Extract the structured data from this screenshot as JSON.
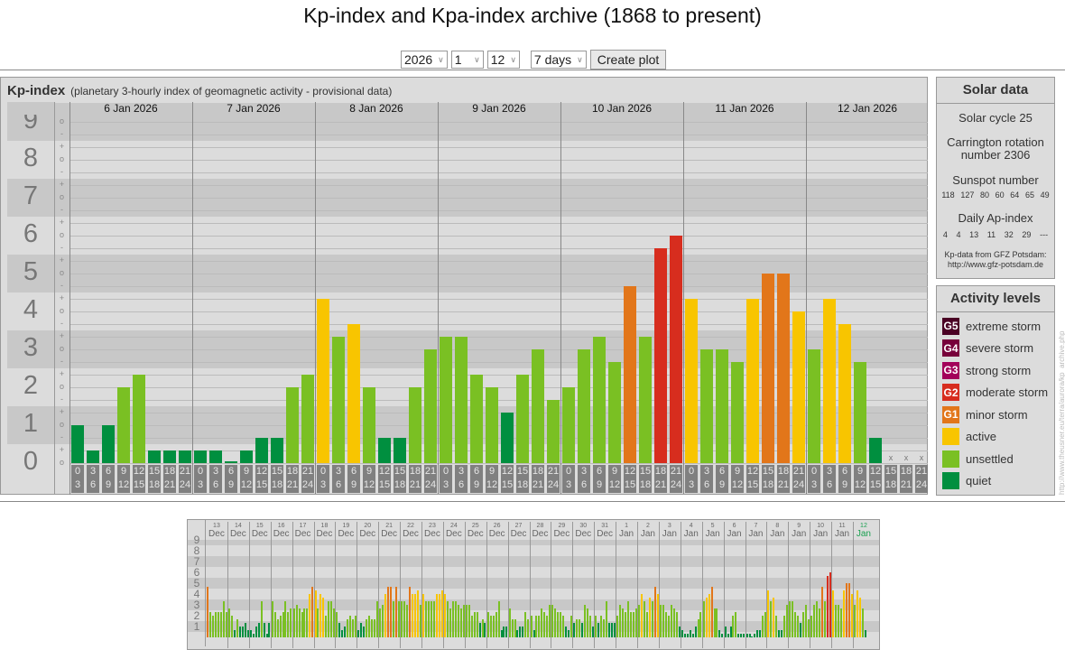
{
  "title": "Kp-index and Kpa-index archive (1868 to present)",
  "controls": {
    "year": "2026",
    "month": "1",
    "day": "12",
    "range": "7 days",
    "create_label": "Create plot"
  },
  "panel": {
    "heading": "Kp-index",
    "subheading": "(planetary 3-hourly index of geomagnetic activity - provisional data)"
  },
  "chart_data": {
    "type": "bar",
    "title": "Kp-index",
    "y_ticks": [
      "0",
      "1",
      "2",
      "3",
      "4",
      "5",
      "6",
      "7",
      "8",
      "9"
    ],
    "y_signs": [
      "+",
      "o",
      "-"
    ],
    "ylim": [
      0,
      9
    ],
    "days": [
      "6 Jan 2026",
      "7 Jan 2026",
      "8 Jan 2026",
      "9 Jan 2026",
      "10 Jan 2026",
      "11 Jan 2026",
      "12 Jan 2026"
    ],
    "hour_intervals": [
      [
        "0",
        "3"
      ],
      [
        "3",
        "6"
      ],
      [
        "6",
        "9"
      ],
      [
        "9",
        "12"
      ],
      [
        "12",
        "15"
      ],
      [
        "15",
        "18"
      ],
      [
        "18",
        "21"
      ],
      [
        "21",
        "24"
      ]
    ],
    "missing_mark": "x",
    "values": [
      [
        1,
        0.33,
        1,
        2,
        2.33,
        0.33,
        0.33,
        0.33
      ],
      [
        0.33,
        0.33,
        0,
        0.33,
        0.67,
        0.67,
        2,
        2.33
      ],
      [
        4.33,
        3.33,
        3.67,
        2,
        0.67,
        0.67,
        2,
        3
      ],
      [
        3.33,
        3.33,
        2.33,
        2,
        1.33,
        2.33,
        3,
        1.67
      ],
      [
        2,
        3,
        3.33,
        2.67,
        4.67,
        3.33,
        5.67,
        6
      ],
      [
        4.33,
        3,
        3,
        2.67,
        4.33,
        5,
        5,
        4
      ],
      [
        3,
        4.33,
        3.67,
        2.67,
        0.67,
        null,
        null,
        null
      ]
    ]
  },
  "overview_chart": {
    "type": "bar",
    "y_ticks": [
      "1",
      "2",
      "3",
      "4",
      "5",
      "6",
      "7",
      "8",
      "9"
    ],
    "days": [
      {
        "d": "13",
        "m": "Dec"
      },
      {
        "d": "14",
        "m": "Dec"
      },
      {
        "d": "15",
        "m": "Dec"
      },
      {
        "d": "16",
        "m": "Dec"
      },
      {
        "d": "17",
        "m": "Dec"
      },
      {
        "d": "18",
        "m": "Dec"
      },
      {
        "d": "19",
        "m": "Dec"
      },
      {
        "d": "20",
        "m": "Dec"
      },
      {
        "d": "21",
        "m": "Dec"
      },
      {
        "d": "22",
        "m": "Dec"
      },
      {
        "d": "23",
        "m": "Dec"
      },
      {
        "d": "24",
        "m": "Dec"
      },
      {
        "d": "25",
        "m": "Dec"
      },
      {
        "d": "26",
        "m": "Dec"
      },
      {
        "d": "27",
        "m": "Dec"
      },
      {
        "d": "28",
        "m": "Dec"
      },
      {
        "d": "29",
        "m": "Dec"
      },
      {
        "d": "30",
        "m": "Dec"
      },
      {
        "d": "31",
        "m": "Dec"
      },
      {
        "d": "1",
        "m": "Jan"
      },
      {
        "d": "2",
        "m": "Jan"
      },
      {
        "d": "3",
        "m": "Jan"
      },
      {
        "d": "4",
        "m": "Jan"
      },
      {
        "d": "5",
        "m": "Jan"
      },
      {
        "d": "6",
        "m": "Jan"
      },
      {
        "d": "7",
        "m": "Jan"
      },
      {
        "d": "8",
        "m": "Jan"
      },
      {
        "d": "9",
        "m": "Jan"
      },
      {
        "d": "10",
        "m": "Jan"
      },
      {
        "d": "11",
        "m": "Jan"
      },
      {
        "d": "12",
        "m": "Jan"
      }
    ],
    "current_day_color": "#1aa050",
    "values": [
      [
        4.67,
        2.33,
        2,
        2.33,
        2.33,
        2.33,
        3.33,
        2.33
      ],
      [
        2.67,
        2,
        0.67,
        1.67,
        1,
        1,
        1.33,
        0.67
      ],
      [
        0.67,
        0.33,
        1,
        1.33,
        3.33,
        1.33,
        0.33,
        1.33
      ],
      [
        3.33,
        2.33,
        1.67,
        2,
        2.33,
        3.33,
        2.33,
        2.67
      ],
      [
        2.67,
        3,
        2.67,
        2.33,
        2.67,
        2.67,
        4,
        4.67
      ],
      [
        4.33,
        2.67,
        4,
        3.67,
        2,
        3.33,
        3.33,
        2.67
      ],
      [
        2.33,
        1.33,
        0.67,
        1,
        1.67,
        2,
        1.67,
        2
      ],
      [
        0.67,
        1.33,
        1,
        1.67,
        2,
        1.67,
        1.67,
        3.33
      ],
      [
        2.67,
        3,
        4,
        4.67,
        4.67,
        3.33,
        4.67,
        3.33
      ],
      [
        3.33,
        3.33,
        3,
        4.67,
        4,
        4,
        4.33,
        3
      ],
      [
        4,
        3.33,
        3.33,
        3.33,
        3.33,
        4,
        4,
        4.33
      ],
      [
        4,
        3.33,
        2.67,
        3.33,
        3.33,
        3,
        2.67,
        3
      ],
      [
        3,
        3,
        2,
        2.33,
        2.33,
        1.33,
        1.67,
        1.33
      ],
      [
        2.33,
        2,
        2,
        2.33,
        3.33,
        0.67,
        1,
        1
      ],
      [
        2.67,
        1.67,
        1.67,
        0.67,
        1,
        1,
        2.33,
        1.67
      ],
      [
        2,
        0.67,
        2,
        2,
        2.67,
        2.33,
        2,
        3
      ],
      [
        3,
        2.67,
        2.33,
        2.33,
        2,
        1,
        0.67,
        2
      ],
      [
        1.33,
        1.67,
        1.67,
        1.33,
        3,
        2.67,
        2,
        1
      ],
      [
        2,
        1.33,
        2,
        1.67,
        3.33,
        1.33,
        1.33,
        1.33
      ],
      [
        2,
        3,
        2.67,
        2.33,
        3.33,
        2.33,
        2.33,
        2.67
      ],
      [
        3,
        4,
        3.33,
        2.33,
        3.67,
        3.33,
        4.67,
        4
      ],
      [
        3,
        3,
        2.33,
        2,
        3,
        2.67,
        2.33,
        1
      ],
      [
        0.67,
        0.33,
        0.33,
        0.67,
        0.33,
        1,
        1.67,
        2.33
      ],
      [
        3.33,
        3.67,
        4,
        4.67,
        2.67,
        2.67,
        0.67,
        0.33
      ],
      [
        1,
        0.33,
        1,
        2,
        2.33,
        0.33,
        0.33,
        0.33
      ],
      [
        0.33,
        0.33,
        0,
        0.33,
        0.67,
        0.67,
        2,
        2.33
      ],
      [
        4.33,
        3.33,
        3.67,
        2,
        0.67,
        0.67,
        2,
        3
      ],
      [
        3.33,
        3.33,
        2.33,
        2,
        1.33,
        2.33,
        3,
        1.67
      ],
      [
        2,
        3,
        3.33,
        2.67,
        4.67,
        3.33,
        5.67,
        6
      ],
      [
        4.33,
        3,
        3,
        2.67,
        4.33,
        5,
        5,
        4
      ],
      [
        3,
        4.33,
        3.67,
        2.67,
        0.67,
        null,
        null,
        null
      ]
    ]
  },
  "solar": {
    "heading": "Solar data",
    "cycle": "Solar cycle 25",
    "carrington_1": "Carrington rotation",
    "carrington_2": "number 2306",
    "sunspot_label": "Sunspot number",
    "sunspots": [
      "118",
      "127",
      "80",
      "60",
      "64",
      "65",
      "49"
    ],
    "ap_label": "Daily Ap-index",
    "ap": [
      "4",
      "4",
      "13",
      "11",
      "32",
      "29",
      "---"
    ],
    "source_1": "Kp-data from GFZ Potsdam:",
    "source_2": "http://www.gfz-potsdam.de"
  },
  "activity": {
    "heading": "Activity levels",
    "levels": [
      {
        "code": "G5",
        "label": "extreme storm",
        "color": "#4a0024"
      },
      {
        "code": "G4",
        "label": "severe storm",
        "color": "#77003a"
      },
      {
        "code": "G3",
        "label": "strong storm",
        "color": "#a3005a"
      },
      {
        "code": "G2",
        "label": "moderate storm",
        "color": "#d72d1e"
      },
      {
        "code": "G1",
        "label": "minor storm",
        "color": "#e2761a"
      },
      {
        "code": "",
        "label": "active",
        "color": "#f8c500"
      },
      {
        "code": "",
        "label": "unsettled",
        "color": "#7ac023"
      },
      {
        "code": "",
        "label": "quiet",
        "color": "#008f3f"
      }
    ]
  },
  "side_url": "http://www.theusner.eu/terra/aurora/kp_archive.php"
}
